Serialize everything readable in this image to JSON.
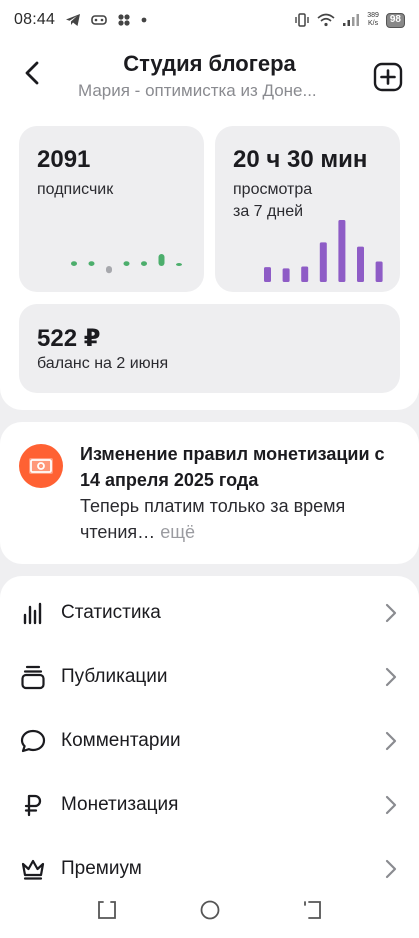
{
  "status_bar": {
    "time": "08:44",
    "speed_top": "389",
    "speed_bottom": "K/s",
    "battery": "98"
  },
  "header": {
    "title": "Студия блогера",
    "subtitle": "Мария - оптимистка из Доне..."
  },
  "stats": {
    "subscribers": {
      "value": "2091",
      "label": "подписчик",
      "trend": [
        0.4,
        0.4,
        -0.6,
        0.4,
        0.4,
        1.0,
        0.1
      ]
    },
    "views": {
      "value": "20 ч 30 мин",
      "label_line1": "просмотра",
      "label_line2": "за 7 дней",
      "bars": [
        0.24,
        0.22,
        0.25,
        0.64,
        1.0,
        0.57,
        0.33
      ]
    },
    "balance": {
      "value": "522 ₽",
      "label": "баланс на 2 июня"
    }
  },
  "promo": {
    "title": "Изменение правил монетизации с 14 апреля 2025 года",
    "text": "Теперь платим только за время чтения…",
    "more": "ещё"
  },
  "menu": {
    "items": [
      {
        "label": "Статистика",
        "icon": "stats-icon"
      },
      {
        "label": "Публикации",
        "icon": "publications-icon"
      },
      {
        "label": "Комментарии",
        "icon": "comment-icon"
      },
      {
        "label": "Монетизация",
        "icon": "ruble-icon"
      },
      {
        "label": "Премиум",
        "icon": "crown-icon"
      }
    ]
  },
  "colors": {
    "accent_green": "#4cae6c",
    "accent_purple": "#8e5cc6",
    "promo_orange": "#ff6133",
    "muted_text": "#8a8b90"
  }
}
